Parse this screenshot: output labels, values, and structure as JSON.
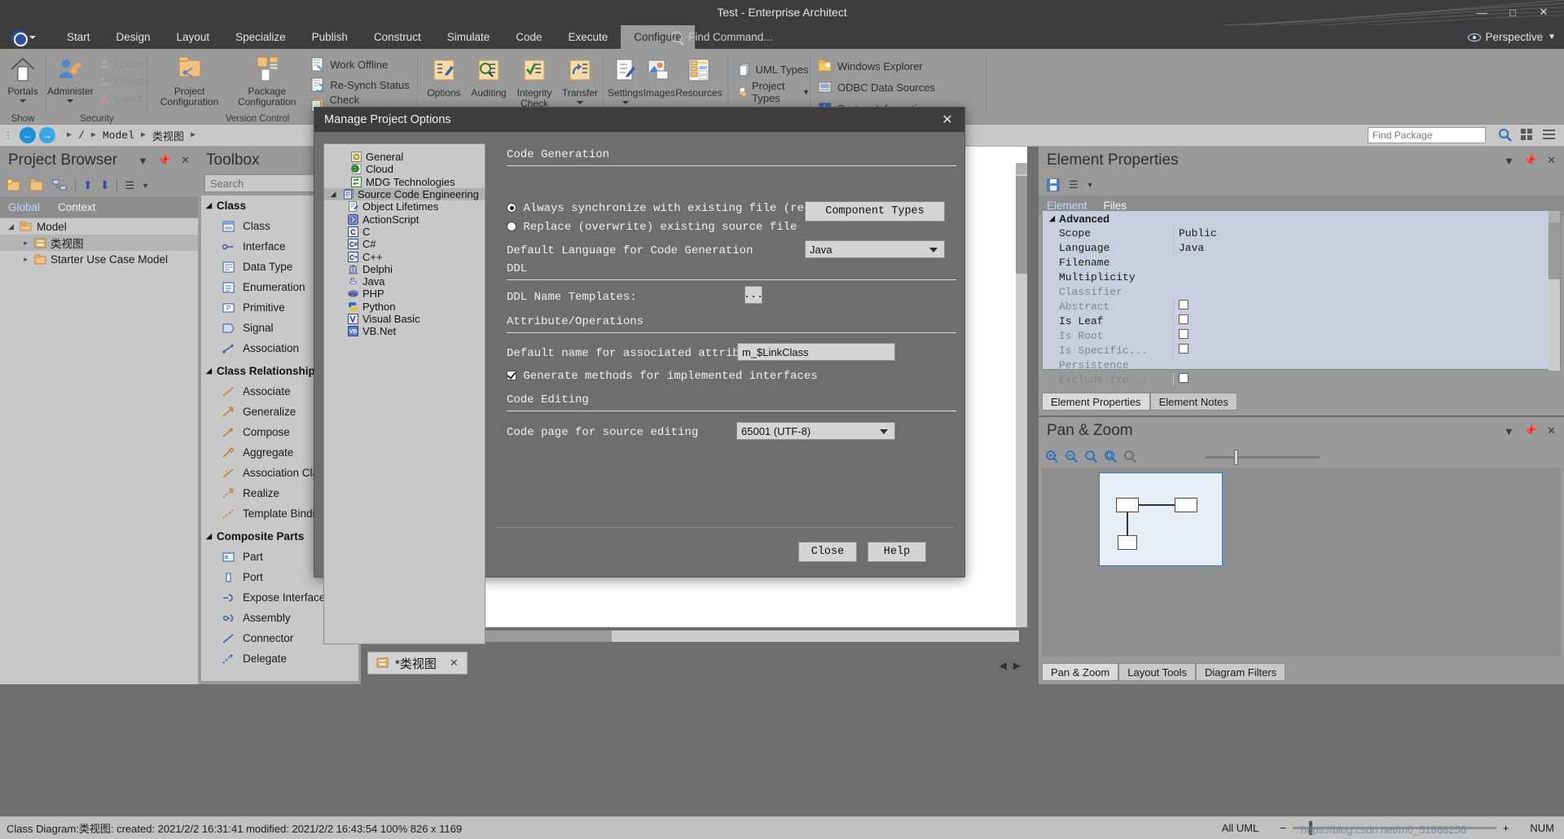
{
  "window": {
    "title": "Test - Enterprise Architect",
    "minimize": "—",
    "maximize": "□",
    "close": "✕"
  },
  "ribbon": {
    "tabs": [
      {
        "label": "Start",
        "active": false
      },
      {
        "label": "Design",
        "active": false
      },
      {
        "label": "Layout",
        "active": false
      },
      {
        "label": "Specialize",
        "active": false
      },
      {
        "label": "Publish",
        "active": false
      },
      {
        "label": "Construct",
        "active": false
      },
      {
        "label": "Simulate",
        "active": false
      },
      {
        "label": "Code",
        "active": false
      },
      {
        "label": "Execute",
        "active": false
      },
      {
        "label": "Configure",
        "active": true
      }
    ],
    "find_command": "Find Command...",
    "perspective": "Perspective",
    "groups": {
      "show": {
        "label": "Show",
        "portals": "Portals"
      },
      "security": {
        "label": "Security",
        "administer": "Administer",
        "users": "Users",
        "groups": "Groups",
        "locks": "Locks"
      },
      "version_control": {
        "label": "Version Control",
        "project_configuration": "Project\nConfiguration",
        "package_configuration": "Package\nConfiguration",
        "work_offline": "Work Offline",
        "resynch_status": "Re-Synch Status",
        "check_configuration": "Check Configuration"
      },
      "model": {
        "options": "Options",
        "auditing": "Auditing",
        "integrity_check": "Integrity\nCheck",
        "transfer": "Transfer"
      },
      "reference": {
        "settings": "Settings",
        "images": "Images",
        "resources": "Resources",
        "uml_types": "UML Types",
        "project_types": "Project Types"
      },
      "system": {
        "windows_explorer": "Windows Explorer",
        "odbc_data_sources": "ODBC Data Sources",
        "system_information": "System Information"
      }
    }
  },
  "breadcrumb": {
    "items": [
      "/",
      "Model",
      "类视图"
    ],
    "back": "←",
    "forward": "→",
    "package_search_placeholder": "Find Package"
  },
  "project_browser": {
    "title": "Project Browser",
    "tabs": [
      "Global",
      "Context"
    ],
    "tree": [
      {
        "label": "Model",
        "depth": 0,
        "toggle": "◢",
        "icon": "model-folder-icon"
      },
      {
        "label": "类视图",
        "depth": 1,
        "toggle": "▸",
        "icon": "diagram-icon",
        "selected": true
      },
      {
        "label": "Starter Use Case Model",
        "depth": 1,
        "toggle": "▸",
        "icon": "package-icon"
      }
    ]
  },
  "toolbox": {
    "title": "Toolbox",
    "search_placeholder": "Search",
    "sections": [
      {
        "header": "Class",
        "items": [
          "Class",
          "Interface",
          "Data Type",
          "Enumeration",
          "Primitive",
          "Signal",
          "Association"
        ]
      },
      {
        "header": "Class Relationships",
        "items": [
          "Associate",
          "Generalize",
          "Compose",
          "Aggregate",
          "Association Class",
          "Realize",
          "Template Binding"
        ]
      },
      {
        "header": "Composite Parts",
        "items": [
          "Part",
          "Port",
          "Expose Interface",
          "Assembly",
          "Connector",
          "Delegate"
        ]
      }
    ]
  },
  "document_tab": {
    "label": "*类视图",
    "close": "✕"
  },
  "element_properties": {
    "title": "Element Properties",
    "tabs": [
      "Element",
      "Files"
    ],
    "group_header": "Advanced",
    "rows": [
      {
        "key": "Scope",
        "value": "Public",
        "type": "text",
        "dim": false
      },
      {
        "key": "Language",
        "value": "Java",
        "type": "text",
        "dim": false
      },
      {
        "key": "Filename",
        "value": "",
        "type": "text",
        "dim": false
      },
      {
        "key": "Multiplicity",
        "value": "",
        "type": "text",
        "dim": false
      },
      {
        "key": "Classifier",
        "value": "",
        "type": "text",
        "dim": true
      },
      {
        "key": "Abstract",
        "value": "",
        "type": "check",
        "dim": true
      },
      {
        "key": "Is Leaf",
        "value": "",
        "type": "check",
        "dim": false
      },
      {
        "key": "Is Root",
        "value": "",
        "type": "check",
        "dim": true
      },
      {
        "key": "Is Specific...",
        "value": "",
        "type": "check",
        "dim": true
      },
      {
        "key": "Persistence",
        "value": "",
        "type": "text",
        "dim": true
      },
      {
        "key": "Exclude fro...",
        "value": "",
        "type": "check",
        "dim": true
      }
    ],
    "bottom_tabs": [
      {
        "label": "Element Properties",
        "active": true
      },
      {
        "label": "Element Notes",
        "active": false
      }
    ]
  },
  "pan_zoom": {
    "title": "Pan & Zoom",
    "bottom_tabs": [
      {
        "label": "Pan & Zoom",
        "active": true
      },
      {
        "label": "Layout Tools",
        "active": false
      },
      {
        "label": "Diagram Filters",
        "active": false
      }
    ]
  },
  "dialog": {
    "title": "Manage Project Options",
    "close": "✕",
    "tree": [
      {
        "label": "General",
        "depth": 0,
        "icon": "general-gear-icon",
        "toggle": ""
      },
      {
        "label": "Cloud",
        "depth": 0,
        "icon": "cloud-globe-icon",
        "toggle": ""
      },
      {
        "label": "MDG Technologies",
        "depth": 0,
        "icon": "mdg-icon",
        "toggle": ""
      },
      {
        "label": "Source Code Engineering",
        "depth": 0,
        "icon": "source-code-icon",
        "toggle": "◢",
        "selected": true
      },
      {
        "label": "Object Lifetimes",
        "depth": 1,
        "icon": "object-lifetimes-icon",
        "toggle": ""
      },
      {
        "label": "ActionScript",
        "depth": 1,
        "icon": "actionscript-icon",
        "toggle": ""
      },
      {
        "label": "C",
        "depth": 1,
        "icon": "c-icon",
        "toggle": ""
      },
      {
        "label": "C#",
        "depth": 1,
        "icon": "csharp-icon",
        "toggle": ""
      },
      {
        "label": "C++",
        "depth": 1,
        "icon": "cpp-icon",
        "toggle": ""
      },
      {
        "label": "Delphi",
        "depth": 1,
        "icon": "delphi-icon",
        "toggle": ""
      },
      {
        "label": "Java",
        "depth": 1,
        "icon": "java-icon",
        "toggle": ""
      },
      {
        "label": "PHP",
        "depth": 1,
        "icon": "php-icon",
        "toggle": ""
      },
      {
        "label": "Python",
        "depth": 1,
        "icon": "python-icon",
        "toggle": ""
      },
      {
        "label": "Visual Basic",
        "depth": 1,
        "icon": "visualbasic-icon",
        "toggle": ""
      },
      {
        "label": "VB.Net",
        "depth": 1,
        "icon": "vbnet-icon",
        "toggle": ""
      }
    ],
    "sections": {
      "code_generation": {
        "header": "Code Generation",
        "radio_always": "Always synchronize with existing file (recommended)",
        "radio_replace": "Replace (overwrite) existing source file",
        "radio_selected": "always",
        "component_types_button": "Component Types",
        "default_language_label": "Default Language for Code Generation",
        "default_language_value": "Java"
      },
      "ddl": {
        "header": "DDL",
        "name_templates_label": "DDL Name Templates:",
        "browse_button": "..."
      },
      "attribute_operations": {
        "header": "Attribute/Operations",
        "default_name_label": "Default name for associated attribute",
        "default_name_value": "m_$LinkClass",
        "generate_methods_label": "Generate methods for implemented interfaces",
        "generate_methods_checked": true
      },
      "code_editing": {
        "header": "Code Editing",
        "code_page_label": "Code page for source editing",
        "code_page_value": "65001 (UTF-8)"
      }
    },
    "buttons": {
      "close": "Close",
      "help": "Help"
    }
  },
  "status_bar": {
    "left": "Class Diagram:类视图:  created: 2021/2/2 16:31:41 modified: 2021/2/2 16:43:54   100%  826 x 1169",
    "uml_profile": "All UML",
    "zoom_minus": "−",
    "zoom_plus": "+",
    "num_indicator": "NUM",
    "watermark": "https://blog.csdn.net/m0_51868256"
  }
}
